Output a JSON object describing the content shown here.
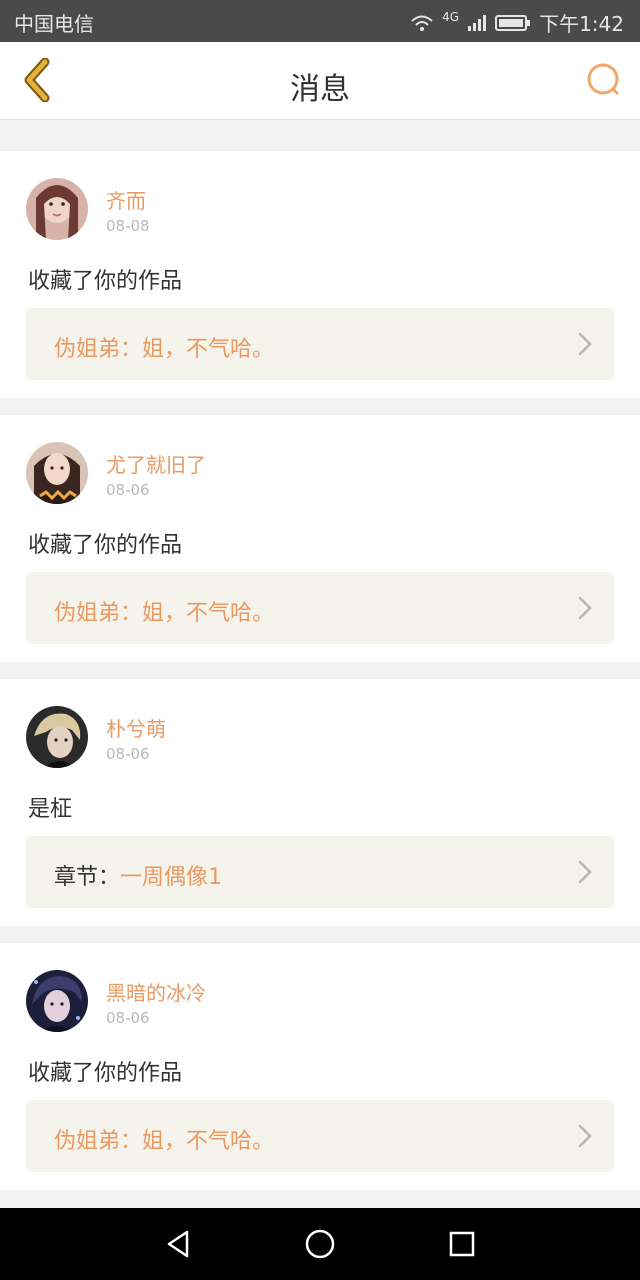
{
  "status_bar": {
    "carrier": "中国电信",
    "network": "4G",
    "time": "下午1:42"
  },
  "header": {
    "title": "消息",
    "back_icon": "chevron-left-icon",
    "search_icon": "search-icon"
  },
  "messages": [
    {
      "name": "齐而",
      "date": "08-08",
      "action": "收藏了你的作品",
      "ref_prefix": "",
      "ref_text": "伪姐弟：姐，不气哈。"
    },
    {
      "name": "尤了就旧了",
      "date": "08-06",
      "action": "收藏了你的作品",
      "ref_prefix": "",
      "ref_text": "伪姐弟：姐，不气哈。"
    },
    {
      "name": "朴兮萌",
      "date": "08-06",
      "action": "是柾",
      "ref_prefix": "章节：",
      "ref_text": "一周偶像1"
    },
    {
      "name": "黑暗的冰冷",
      "date": "08-06",
      "action": "收藏了你的作品",
      "ref_prefix": "",
      "ref_text": "伪姐弟：姐，不气哈。"
    }
  ],
  "colors": {
    "accent": "#e89a62",
    "back_icon": "#e6b13c",
    "ref_bg": "#f4f3ec"
  },
  "nav": {
    "back": "triangle-back-icon",
    "home": "circle-home-icon",
    "recents": "square-recents-icon"
  }
}
